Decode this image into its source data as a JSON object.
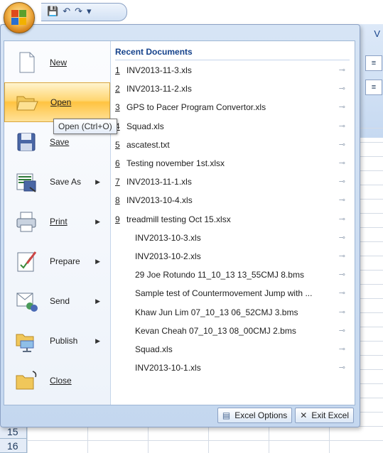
{
  "qat": {
    "save": "💾",
    "undo": "↶",
    "redo": "↷",
    "more": "▾"
  },
  "ribbon": {
    "tab_v": "V"
  },
  "rows": [
    "15",
    "16"
  ],
  "menu": {
    "commands": [
      {
        "label": "New",
        "icon": "new-document-icon"
      },
      {
        "label": "Open",
        "icon": "open-folder-icon"
      },
      {
        "label": "Save",
        "icon": "save-disk-icon"
      },
      {
        "label": "Save As",
        "icon": "save-as-icon"
      },
      {
        "label": "Print",
        "icon": "printer-icon"
      },
      {
        "label": "Prepare",
        "icon": "prepare-icon"
      },
      {
        "label": "Send",
        "icon": "send-icon"
      },
      {
        "label": "Publish",
        "icon": "publish-icon"
      },
      {
        "label": "Close",
        "icon": "close-folder-icon"
      }
    ],
    "tooltip": "Open (Ctrl+O)",
    "recent_title": "Recent Documents",
    "recent": [
      {
        "num": "1",
        "name": "INV2013-11-3.xls"
      },
      {
        "num": "2",
        "name": "INV2013-11-2.xls"
      },
      {
        "num": "3",
        "name": "GPS to Pacer Program Convertor.xls"
      },
      {
        "num": "4",
        "name": "Squad.xls"
      },
      {
        "num": "5",
        "name": "ascatest.txt"
      },
      {
        "num": "6",
        "name": "Testing november 1st.xlsx"
      },
      {
        "num": "7",
        "name": "INV2013-11-1.xls"
      },
      {
        "num": "8",
        "name": "INV2013-10-4.xls"
      },
      {
        "num": "9",
        "name": "treadmill testing Oct 15.xlsx"
      },
      {
        "num": "",
        "name": "INV2013-10-3.xls"
      },
      {
        "num": "",
        "name": "INV2013-10-2.xls"
      },
      {
        "num": "",
        "name": "29 Joe Rotundo 11_10_13 13_55CMJ 8.bms"
      },
      {
        "num": "",
        "name": "Sample test of Countermovement Jump with ..."
      },
      {
        "num": "",
        "name": "Khaw Jun Lim 07_10_13 06_52CMJ 3.bms"
      },
      {
        "num": "",
        "name": "Kevan Cheah 07_10_13 08_00CMJ 2.bms"
      },
      {
        "num": "",
        "name": "Squad.xls"
      },
      {
        "num": "",
        "name": "INV2013-10-1.xls"
      }
    ],
    "excel_options": "Excel Options",
    "exit_excel": "Exit Excel"
  }
}
